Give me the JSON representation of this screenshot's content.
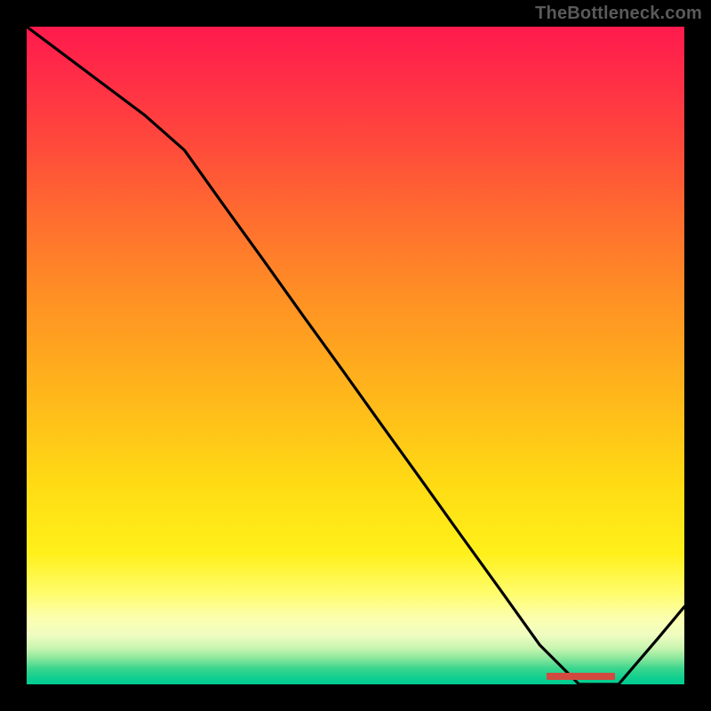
{
  "watermark": "TheBottleneck.com",
  "chart_data": {
    "type": "line",
    "x": [
      0.0,
      0.06,
      0.12,
      0.18,
      0.24,
      0.3,
      0.36,
      0.42,
      0.48,
      0.54,
      0.6,
      0.66,
      0.72,
      0.78,
      0.84,
      0.9,
      0.96,
      1.0
    ],
    "values": [
      1.0,
      0.955,
      0.91,
      0.865,
      0.812,
      0.728,
      0.645,
      0.561,
      0.478,
      0.394,
      0.311,
      0.227,
      0.144,
      0.06,
      0.0,
      0.0,
      0.07,
      0.118
    ],
    "title": "",
    "xlabel": "",
    "ylabel": "",
    "xlim": [
      0,
      1
    ],
    "ylim": [
      0,
      1
    ],
    "gradient_bands": [
      {
        "pos": 0.0,
        "color": "#ff1a4d"
      },
      {
        "pos": 0.08,
        "color": "#ff2e46"
      },
      {
        "pos": 0.18,
        "color": "#ff4a3b"
      },
      {
        "pos": 0.28,
        "color": "#ff6a30"
      },
      {
        "pos": 0.4,
        "color": "#ff8d25"
      },
      {
        "pos": 0.55,
        "color": "#ffb41b"
      },
      {
        "pos": 0.7,
        "color": "#ffdc14"
      },
      {
        "pos": 0.8,
        "color": "#fff01a"
      },
      {
        "pos": 0.86,
        "color": "#fffc6a"
      },
      {
        "pos": 0.9,
        "color": "#fcffb0"
      },
      {
        "pos": 0.925,
        "color": "#effcc0"
      },
      {
        "pos": 0.945,
        "color": "#c8f5b0"
      },
      {
        "pos": 0.96,
        "color": "#8de79e"
      },
      {
        "pos": 0.975,
        "color": "#3fd68e"
      },
      {
        "pos": 0.99,
        "color": "#0fcf8f"
      },
      {
        "pos": 1.0,
        "color": "#00cb91"
      }
    ],
    "marker": {
      "x_start": 0.79,
      "x_end": 0.895,
      "y": 0.988,
      "color": "#d24a3f"
    }
  }
}
